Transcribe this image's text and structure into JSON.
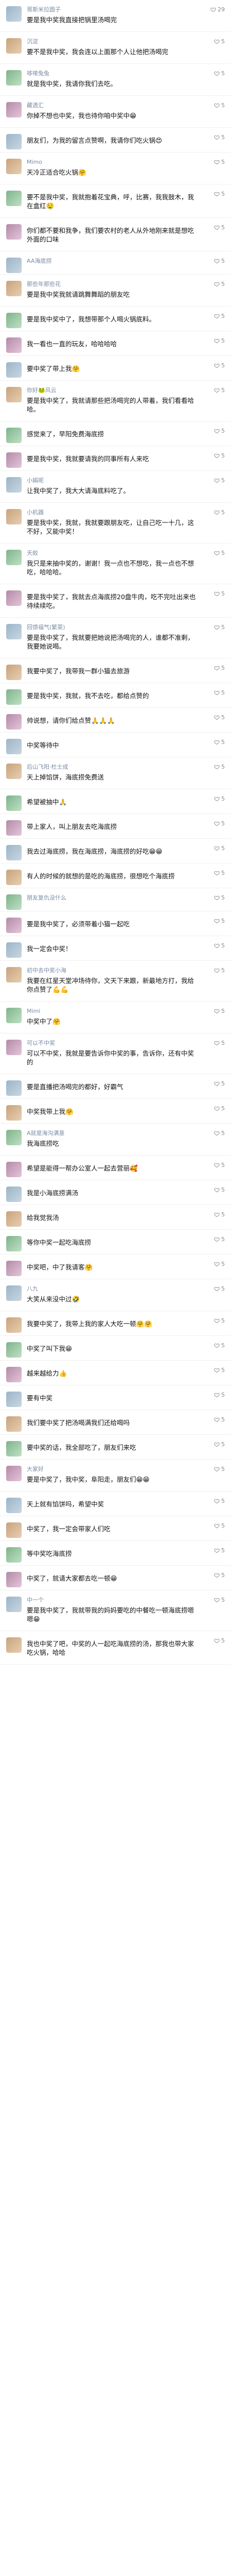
{
  "comments": [
    {
      "name": "哥斯米拉圆子",
      "text": "要是我中奖我直接把锅里汤喝完",
      "likes": "29"
    },
    {
      "name": "沉淀",
      "text": "要不是我中奖，我会连以上面那个人让他把汤喝完",
      "likes": "5"
    },
    {
      "name": "哆嗦兔兔",
      "text": "就是我中奖，我请你我们去吃。",
      "likes": "5"
    },
    {
      "name": "藏透汇",
      "text": "你掉不想也中奖，我也待你咱中奖中😁",
      "likes": "5"
    },
    {
      "name": "",
      "text": "朋友们，为我的留言点赞啊，我请你们吃火锅😍",
      "likes": "5"
    },
    {
      "name": "Mimo",
      "text": "天冷正适合吃火锅🤗",
      "likes": "5"
    },
    {
      "name": "",
      "text": "要不是我中奖，我就抱着花宝典，呼，比赛，我我鼓木，我在盒红🤤",
      "likes": "5"
    },
    {
      "name": "",
      "text": "你们都不要和我争，我们要农村的老人从外地刚来就是想吃外面的口味",
      "likes": "5"
    },
    {
      "name": "AA海底捞",
      "text": "",
      "likes": "5"
    },
    {
      "name": "那些年那些花",
      "text": "要是我中奖我就请跳舞舞蹈的朋友吃",
      "likes": "5"
    },
    {
      "name": "",
      "text": "要是我中奖中了，我想带那个人喝火锅底料。",
      "likes": "5"
    },
    {
      "name": "",
      "text": "我一看也一直的玩友，哈哈哈哈",
      "likes": "5"
    },
    {
      "name": "",
      "text": "要中奖了带上我🤗",
      "likes": "5"
    },
    {
      "name": "你好🐸风云",
      "text": "要是我中奖了，我就请那些把汤喝完的人带着，我们看看哈哈。",
      "likes": "5"
    },
    {
      "name": "",
      "text": "感觉来了，早阳免费海底捞",
      "likes": "5"
    },
    {
      "name": "",
      "text": "要是我中奖，我就要请我的同事所有人来吃",
      "likes": "5"
    },
    {
      "name": "小娟呢",
      "text": "让我中奖了，我大大请海底料吃了。",
      "likes": "5"
    },
    {
      "name": "小机器",
      "text": "要是我中奖，我就，我就要跟朋友吃，让自己吃一十几，这不好，又能中奖！",
      "likes": "5"
    },
    {
      "name": "天蛟",
      "text": "我只是来抽中奖的，谢谢！我一点也不想吃，我一点也不想吃，哈哈哈。",
      "likes": "5"
    },
    {
      "name": "",
      "text": "要是我中奖了，我就去点海底捞20盘牛肉，吃不完吐出来也待续续吃。",
      "likes": "5"
    },
    {
      "name": "回馈福气(繁菜)",
      "text": "要是我中奖了，我就要把她说把汤喝完的人，谁都不准剩，我要她说喝。",
      "likes": "5"
    },
    {
      "name": "",
      "text": "我要中奖了，我带我一群小猫去旅游",
      "likes": "5"
    },
    {
      "name": "",
      "text": "要是我中奖，我就，我不去吃，都给点赞的",
      "likes": "5"
    },
    {
      "name": "",
      "text": "帅说想，请你们给点赞🙏🙏🙏",
      "likes": "5"
    },
    {
      "name": "",
      "text": "中奖等待中",
      "likes": "5"
    },
    {
      "name": "后山飞阳·杜士成",
      "text": "天上掉馅饼，海底捞免费送",
      "likes": "5"
    },
    {
      "name": "",
      "text": "希望被抽中🙏",
      "likes": "5"
    },
    {
      "name": "",
      "text": "带上家人，叫上朋友去吃海底捞",
      "likes": "5"
    },
    {
      "name": "",
      "text": "我去过海底捞，我在海底捞，海底捞的好吃😁😁",
      "likes": "5"
    },
    {
      "name": "",
      "text": "有人的时候的就想的是吃的海底捞，很想吃个海底捞",
      "likes": "5"
    },
    {
      "name": "朋友复仇没什么",
      "text": "",
      "likes": "5"
    },
    {
      "name": "",
      "text": "要是我中奖了，必须带着小猫一起吃",
      "likes": "5"
    },
    {
      "name": "",
      "text": "我一定会中奖！",
      "likes": "5"
    },
    {
      "name": "初中去中奖小海",
      "text": "我要在红星天堂冲场待你，文天下来跟，新最地方打，我给你点赞了💪💪",
      "likes": "5"
    },
    {
      "name": "Mimi",
      "text": "中奖中了🤗",
      "likes": "5"
    },
    {
      "name": "可以不中奖",
      "text": "可以不中奖，我就是要告诉你中奖的事，告诉你，还有中奖的",
      "likes": "5"
    },
    {
      "name": "",
      "text": "要是直播把汤喝完的都好，好霸气",
      "likes": "5"
    },
    {
      "name": "",
      "text": "中奖我带上我🤗",
      "likes": "5"
    },
    {
      "name": "A就是海沟满意",
      "text": "我海底捞吃",
      "likes": "5"
    },
    {
      "name": "",
      "text": "希望是能得一帮办公室人一起去营丽🥰",
      "likes": "5"
    },
    {
      "name": "",
      "text": "我是小海底捞满汤",
      "likes": "5"
    },
    {
      "name": "",
      "text": "给我觉我汤",
      "likes": "5"
    },
    {
      "name": "",
      "text": "等你中奖一起吃海底捞",
      "likes": "5"
    },
    {
      "name": "",
      "text": "中奖吧，中了我请客🤗",
      "likes": "5"
    },
    {
      "name": "八九",
      "text": "大笑从来没中过🤣",
      "likes": "5"
    },
    {
      "name": "",
      "text": "我要中奖了，我带上我的家人大吃一顿🤗🤗",
      "likes": "5"
    },
    {
      "name": "",
      "text": "中奖了叫下我😁",
      "likes": "5"
    },
    {
      "name": "",
      "text": "越来越给力👍",
      "likes": "5"
    },
    {
      "name": "",
      "text": "要有中奖",
      "likes": "5"
    },
    {
      "name": "",
      "text": "我们要中奖了把汤喝满我们还给喝吗",
      "likes": "5"
    },
    {
      "name": "",
      "text": "要中奖的话，我全部吃了，朋友们来吃",
      "likes": "5"
    },
    {
      "name": "大家好",
      "text": "要是中奖了，我中奖，阜阳走，朋友们😁😁",
      "likes": "5"
    },
    {
      "name": "",
      "text": "天上就有馅饼吗，希望中奖",
      "likes": "5"
    },
    {
      "name": "",
      "text": "中奖了，我一定会带家人们吃",
      "likes": "5"
    },
    {
      "name": "",
      "text": "等中奖吃海底捞",
      "likes": "5"
    },
    {
      "name": "",
      "text": "中奖了，就请大家都去吃一顿😁",
      "likes": "5"
    },
    {
      "name": "中一个",
      "text": "要是我中奖了，我就带我的妈妈要吃的中餐吃一顿海底捞嗯嗯😁",
      "likes": "5"
    },
    {
      "name": "",
      "text": "我也中奖了吧，中奖的人一起吃海底捞的汤，那我也带大家吃火锅，哈哈",
      "likes": "5"
    }
  ],
  "icons": {
    "like": "heart-icon"
  }
}
